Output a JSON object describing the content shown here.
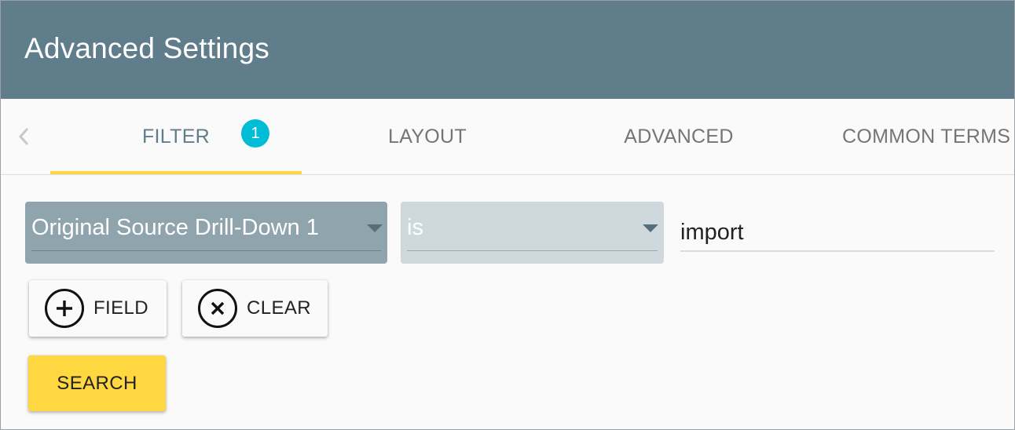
{
  "header": {
    "title": "Advanced Settings"
  },
  "tabs": {
    "items": [
      {
        "label": "FILTER",
        "badge": "1"
      },
      {
        "label": "LAYOUT"
      },
      {
        "label": "ADVANCED"
      },
      {
        "label": "COMMON TERMS"
      }
    ]
  },
  "filter": {
    "field_select": {
      "value": "Original Source Drill-Down 1"
    },
    "operator_select": {
      "value": "is"
    },
    "value_input": {
      "value": "import"
    }
  },
  "buttons": {
    "add_field": "FIELD",
    "clear": "CLEAR",
    "search": "SEARCH"
  }
}
